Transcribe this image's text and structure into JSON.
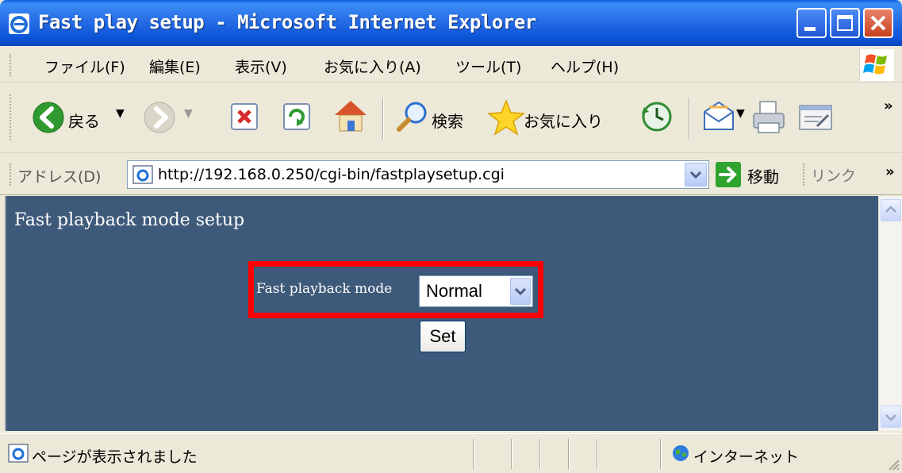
{
  "window": {
    "title": "Fast play setup - Microsoft Internet Explorer"
  },
  "menu": {
    "items": [
      {
        "label": "ファイル(F)"
      },
      {
        "label": "編集(E)"
      },
      {
        "label": "表示(V)"
      },
      {
        "label": "お気に入り(A)"
      },
      {
        "label": "ツール(T)"
      },
      {
        "label": "ヘルプ(H)"
      }
    ]
  },
  "toolbar": {
    "back_label": "戻る",
    "search_label": "検索",
    "favorites_label": "お気に入り",
    "more": "»"
  },
  "address": {
    "label": "アドレス(D)",
    "url": "http://192.168.0.250/cgi-bin/fastplaysetup.cgi",
    "go_label": "移動",
    "links_label": "リンク",
    "links_more": "»"
  },
  "page": {
    "heading": "Fast playback mode setup",
    "field_label": "Fast playback mode",
    "select_value": "Normal",
    "set_button": "Set"
  },
  "status": {
    "text": "ページが表示されました",
    "zone": "インターネット"
  },
  "colors": {
    "content_bg": "#3e5a7a",
    "highlight": "#ff0000",
    "titlebar": "#0c55d8"
  }
}
